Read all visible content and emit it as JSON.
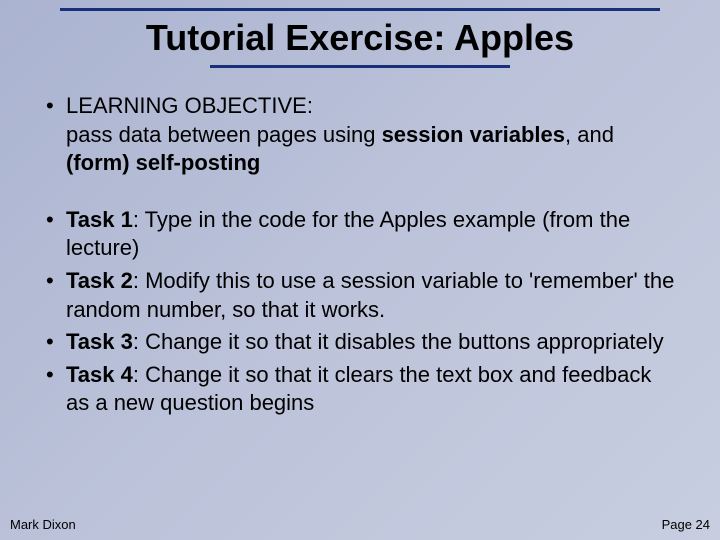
{
  "title": "Tutorial Exercise: Apples",
  "objective": {
    "label": "LEARNING OBJECTIVE:",
    "pre": "pass data between pages using ",
    "bold1": "session variables",
    "mid": ", and ",
    "bold2": "(form) self-posting"
  },
  "tasks": [
    {
      "label": "Task 1",
      "text": ": Type in the code for the Apples example (from the lecture)"
    },
    {
      "label": "Task 2",
      "text": ": Modify this to use a session variable to 'remember' the random number, so that it works."
    },
    {
      "label": "Task 3",
      "text": ": Change it so that it disables the buttons appropriately"
    },
    {
      "label": "Task 4",
      "text": ": Change it so that it clears the text box and feedback as a new question begins"
    }
  ],
  "footer": {
    "author": "Mark Dixon",
    "page": "Page 24"
  }
}
